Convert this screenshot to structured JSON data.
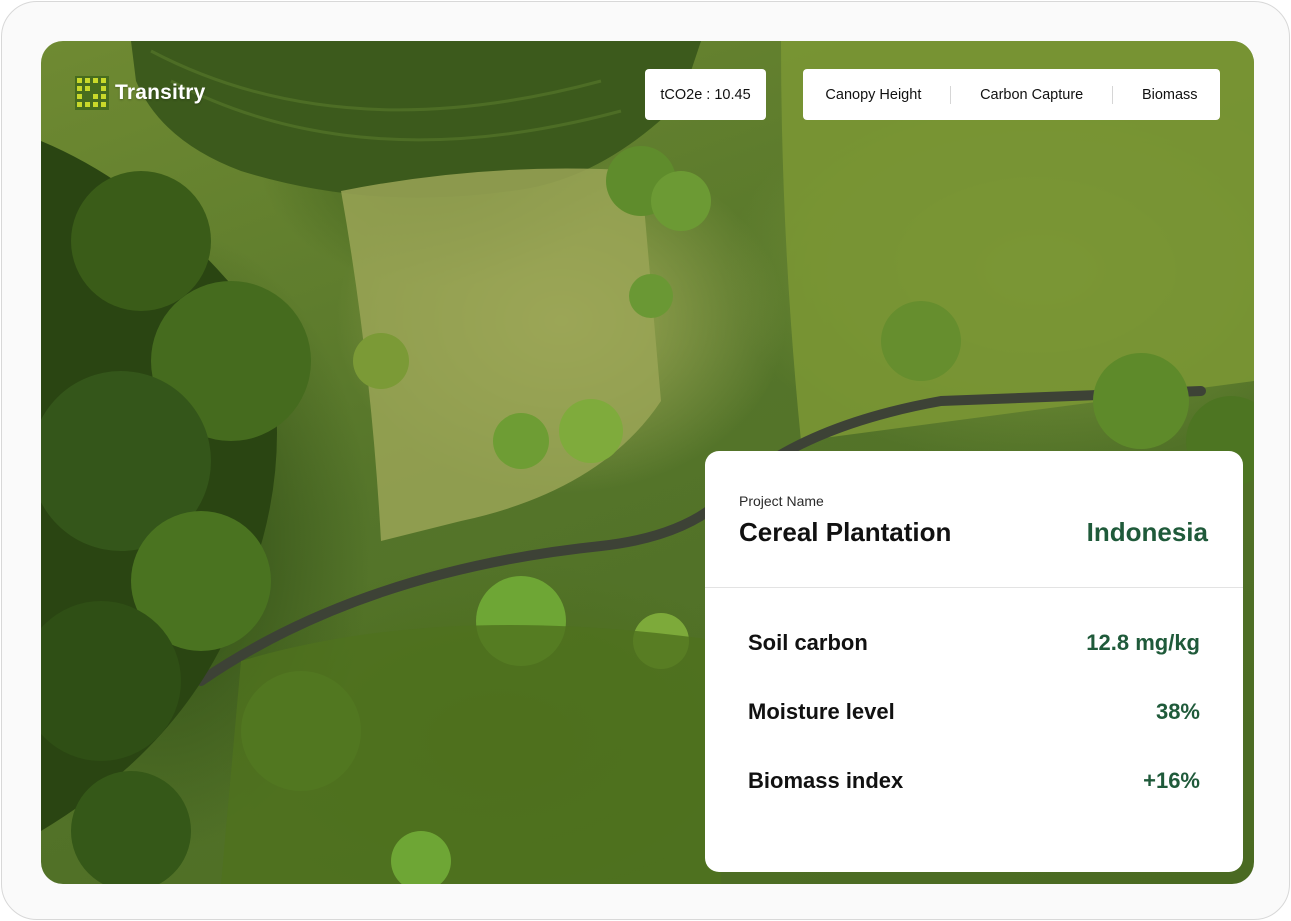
{
  "brand": {
    "name": "Transitry",
    "accent": "#c9d92a"
  },
  "metric_chip": {
    "text": "tCO2e : 10.45"
  },
  "layer_tabs": [
    {
      "label": "Canopy Height"
    },
    {
      "label": "Carbon Capture"
    },
    {
      "label": "Biomass"
    }
  ],
  "project": {
    "label": "Project Name",
    "name": "Cereal Plantation",
    "country": "Indonesia"
  },
  "stats": [
    {
      "label": "Soil carbon",
      "value": "12.8 mg/kg"
    },
    {
      "label": "Moisture level",
      "value": "38%"
    },
    {
      "label": "Biomass index",
      "value": "+16%"
    }
  ],
  "colors": {
    "value_green": "#1f5a3a",
    "card_bg": "#ffffff"
  },
  "background": {
    "icon": "aerial-farmland-photo"
  }
}
